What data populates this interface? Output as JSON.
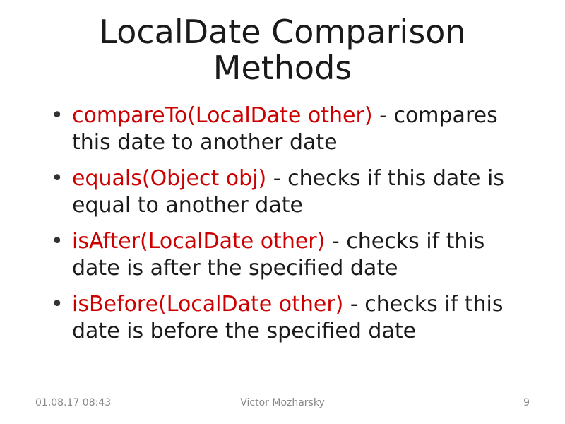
{
  "title": "LocalDate Comparison Methods",
  "bullets": [
    {
      "method": "compareTo(LocalDate other)",
      "desc": " - compares this date to another date"
    },
    {
      "method": "equals(Object obj)",
      "desc": " - checks if this date is equal to another date"
    },
    {
      "method": "isAfter(LocalDate other)",
      "desc": " - checks if this date is after the specified date"
    },
    {
      "method": "isBefore(LocalDate other)",
      "desc": " - checks if this date is before the specified date"
    }
  ],
  "footer": {
    "date": "01.08.17 08:43",
    "author": "Victor Mozharsky",
    "page": "9"
  },
  "colors": {
    "method": "#cc0000",
    "text": "#1a1a1a",
    "footer": "#888888"
  }
}
